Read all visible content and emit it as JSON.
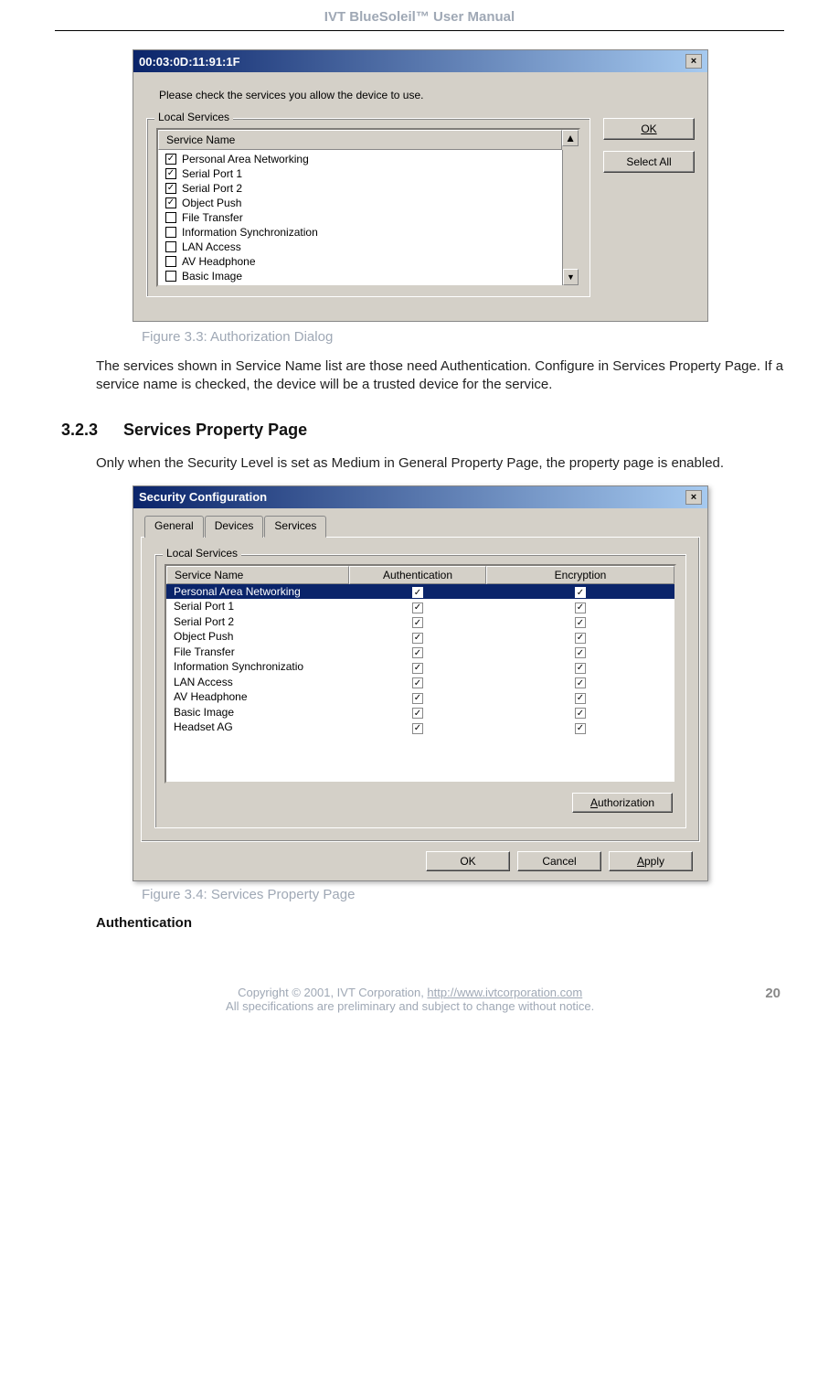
{
  "header": "IVT BlueSoleil™ User Manual",
  "dialog1": {
    "title": "00:03:0D:11:91:1F",
    "close": "×",
    "prompt": "Please check the services you allow the device to use.",
    "fieldset": "Local Services",
    "colheader": "Service Name",
    "rows": [
      {
        "checked": true,
        "label": "Personal Area Networking"
      },
      {
        "checked": true,
        "label": "Serial Port 1"
      },
      {
        "checked": true,
        "label": "Serial Port 2"
      },
      {
        "checked": true,
        "label": "Object Push"
      },
      {
        "checked": false,
        "label": "File Transfer"
      },
      {
        "checked": false,
        "label": "Information Synchronization"
      },
      {
        "checked": false,
        "label": "LAN Access"
      },
      {
        "checked": false,
        "label": "AV Headphone"
      },
      {
        "checked": false,
        "label": "Basic Image"
      }
    ],
    "okbtn": "OK",
    "selectall": "Select All",
    "scrollup": "▲",
    "scrolldown": "▼"
  },
  "figcap1": "Figure 3.3: Authorization Dialog",
  "para1": "The services shown in Service Name list are those need Authentication. Configure in Services Property Page. If a service name is checked, the device will be a trusted device for the service.",
  "sec": {
    "num": "3.2.3",
    "title": "Services Property Page"
  },
  "para2": "Only when the Security Level is set as Medium in General Property Page, the property page is enabled.",
  "dialog2": {
    "title": "Security Configuration",
    "close": "×",
    "tabs": {
      "general": "General",
      "devices": "Devices",
      "services": "Services"
    },
    "fieldset": "Local Services",
    "cols": {
      "name": "Service Name",
      "auth": "Authentication",
      "enc": "Encryption"
    },
    "rows": [
      {
        "name": "Personal Area Networking",
        "auth": true,
        "enc": true,
        "sel": true
      },
      {
        "name": "Serial Port 1",
        "auth": true,
        "enc": true
      },
      {
        "name": "Serial Port 2",
        "auth": true,
        "enc": true
      },
      {
        "name": "Object Push",
        "auth": true,
        "enc": true
      },
      {
        "name": "File Transfer",
        "auth": true,
        "enc": true
      },
      {
        "name": "Information Synchronizatio",
        "auth": true,
        "enc": true
      },
      {
        "name": "LAN Access",
        "auth": true,
        "enc": true
      },
      {
        "name": "AV Headphone",
        "auth": true,
        "enc": true
      },
      {
        "name": "Basic Image",
        "auth": true,
        "enc": true
      },
      {
        "name": "Headset AG",
        "auth": true,
        "enc": true
      }
    ],
    "authbtn": "Authorization",
    "okbtn": "OK",
    "cancelbtn": "Cancel",
    "applybtn": "Apply"
  },
  "figcap2": "Figure 3.4: Services Property Page",
  "subsub": "Authentication",
  "footer": {
    "line1a": "Copyright © 2001, IVT Corporation, ",
    "link": "http://www.ivtcorporation.com",
    "line2": "All specifications are preliminary and subject to change without notice.",
    "page": "20"
  }
}
